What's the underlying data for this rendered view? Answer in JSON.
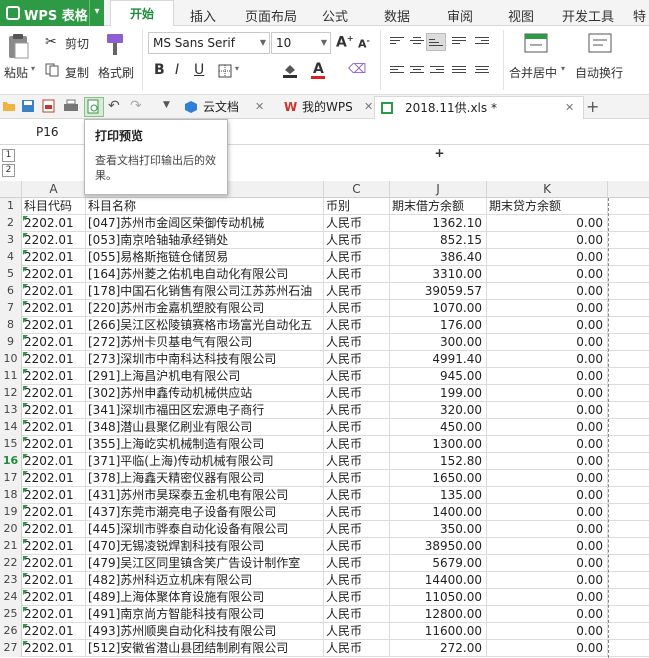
{
  "app": {
    "menu_label": "WPS 表格"
  },
  "ribbon_tabs": [
    "开始",
    "插入",
    "页面布局",
    "公式",
    "数据",
    "审阅",
    "视图",
    "开发工具",
    "特色"
  ],
  "ribbon": {
    "paste": "粘贴",
    "cut": "剪切",
    "copy": "复制",
    "format_painter": "格式刷",
    "font_name": "MS Sans Serif",
    "font_size": "10",
    "merge_center": "合并居中",
    "wrap_text": "自动换行"
  },
  "doc_tabs": {
    "cloud": "云文档",
    "mywps": "我的WPS",
    "file": "2018.11供.xls *"
  },
  "cell_ref": "P16",
  "tooltip": {
    "title": "打印预览",
    "body": "查看文档打印输出后的效果。"
  },
  "outline_levels": [
    "1",
    "2"
  ],
  "sheet": {
    "columns": [
      "A",
      "B",
      "C",
      "J",
      "K"
    ],
    "selected_row": "16",
    "rows": [
      {
        "n": "1",
        "a": "科目代码",
        "b": "科目名称",
        "c": "币别",
        "j": "期末借方余额",
        "k": "期末贷方余额"
      },
      {
        "n": "2",
        "a": "2202.01",
        "b": "[047]苏州市金阊区荣御传动机械",
        "c": "人民币",
        "j": "1362.10",
        "k": "0.00"
      },
      {
        "n": "3",
        "a": "2202.01",
        "b": "[053]南京哈轴轴承经销处",
        "c": "人民币",
        "j": "852.15",
        "k": "0.00"
      },
      {
        "n": "4",
        "a": "2202.01",
        "b": "[055]易格斯拖链仓储贸易",
        "c": "人民币",
        "j": "386.40",
        "k": "0.00"
      },
      {
        "n": "5",
        "a": "2202.01",
        "b": "[164]苏州菱之佑机电自动化有限公司",
        "c": "人民币",
        "j": "3310.00",
        "k": "0.00"
      },
      {
        "n": "6",
        "a": "2202.01",
        "b": "[178]中国石化销售有限公司江苏苏州石油",
        "c": "人民币",
        "j": "39059.57",
        "k": "0.00"
      },
      {
        "n": "7",
        "a": "2202.01",
        "b": "[220]苏州市金嘉机塑胶有限公司",
        "c": "人民币",
        "j": "1070.00",
        "k": "0.00"
      },
      {
        "n": "8",
        "a": "2202.01",
        "b": "[266]吴江区松陵镇赛格市场富光自动化五",
        "c": "人民币",
        "j": "176.00",
        "k": "0.00"
      },
      {
        "n": "9",
        "a": "2202.01",
        "b": "[272]苏州卡贝基电气有限公司",
        "c": "人民币",
        "j": "300.00",
        "k": "0.00"
      },
      {
        "n": "10",
        "a": "2202.01",
        "b": "[273]深圳市中南科达科技有限公司",
        "c": "人民币",
        "j": "4991.40",
        "k": "0.00"
      },
      {
        "n": "11",
        "a": "2202.01",
        "b": "[291]上海昌沪机电有限公司",
        "c": "人民币",
        "j": "945.00",
        "k": "0.00"
      },
      {
        "n": "12",
        "a": "2202.01",
        "b": "[302]苏州申鑫传动机械供应站",
        "c": "人民币",
        "j": "199.00",
        "k": "0.00"
      },
      {
        "n": "13",
        "a": "2202.01",
        "b": "[341]深圳市福田区宏源电子商行",
        "c": "人民币",
        "j": "320.00",
        "k": "0.00"
      },
      {
        "n": "14",
        "a": "2202.01",
        "b": "[348]潜山县聚亿刷业有限公司",
        "c": "人民币",
        "j": "450.00",
        "k": "0.00"
      },
      {
        "n": "15",
        "a": "2202.01",
        "b": "[355]上海屹实机械制造有限公司",
        "c": "人民币",
        "j": "1300.00",
        "k": "0.00"
      },
      {
        "n": "16",
        "a": "2202.01",
        "b": "[371]平临(上海)传动机械有限公司",
        "c": "人民币",
        "j": "152.80",
        "k": "0.00"
      },
      {
        "n": "17",
        "a": "2202.01",
        "b": "[378]上海鑫天精密仪器有限公司",
        "c": "人民币",
        "j": "1650.00",
        "k": "0.00"
      },
      {
        "n": "18",
        "a": "2202.01",
        "b": "[431]苏州市昊琛泰五金机电有限公司",
        "c": "人民币",
        "j": "135.00",
        "k": "0.00"
      },
      {
        "n": "19",
        "a": "2202.01",
        "b": "[437]东莞市潮亮电子设备有限公司",
        "c": "人民币",
        "j": "1400.00",
        "k": "0.00"
      },
      {
        "n": "20",
        "a": "2202.01",
        "b": "[445]深圳市骅泰自动化设备有限公司",
        "c": "人民币",
        "j": "350.00",
        "k": "0.00"
      },
      {
        "n": "21",
        "a": "2202.01",
        "b": "[470]无锡凌锐焊割科技有限公司",
        "c": "人民币",
        "j": "38950.00",
        "k": "0.00"
      },
      {
        "n": "22",
        "a": "2202.01",
        "b": "[479]吴江区同里镇含笑广告设计制作室",
        "c": "人民币",
        "j": "5679.00",
        "k": "0.00"
      },
      {
        "n": "23",
        "a": "2202.01",
        "b": "[482]苏州科迈立机床有限公司",
        "c": "人民币",
        "j": "14400.00",
        "k": "0.00"
      },
      {
        "n": "24",
        "a": "2202.01",
        "b": "[489]上海体聚体育设施有限公司",
        "c": "人民币",
        "j": "11050.00",
        "k": "0.00"
      },
      {
        "n": "25",
        "a": "2202.01",
        "b": "[491]南京尚方智能科技有限公司",
        "c": "人民币",
        "j": "12800.00",
        "k": "0.00"
      },
      {
        "n": "26",
        "a": "2202.01",
        "b": "[493]苏州顺奥自动化科技有限公司",
        "c": "人民币",
        "j": "11600.00",
        "k": "0.00"
      },
      {
        "n": "27",
        "a": "2202.01",
        "b": "[512]安徽省潜山县团结制刷有限公司",
        "c": "人民币",
        "j": "272.00",
        "k": "0.00"
      }
    ]
  },
  "colors": {
    "brand_green": "#2f9a45",
    "active_tab_text": "#1f8c3b"
  }
}
